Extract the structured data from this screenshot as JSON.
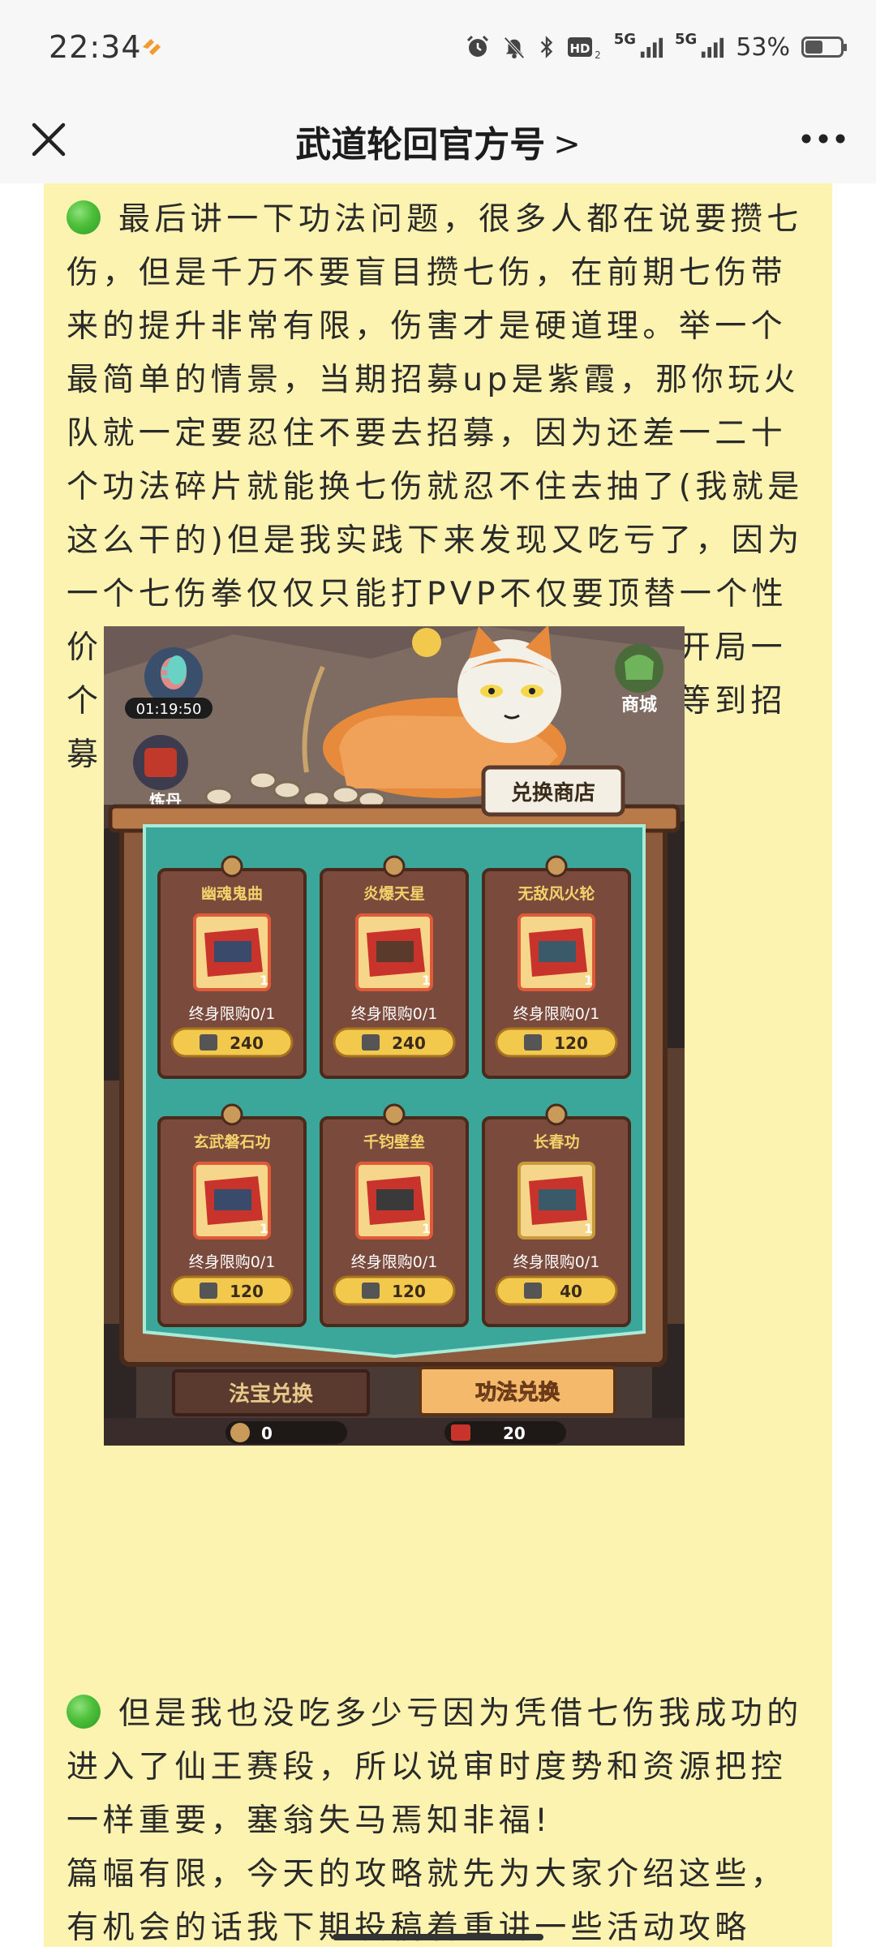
{
  "status_bar": {
    "time": "22:34",
    "network_1": "5G",
    "network_2": "5G",
    "hd_badge": "HD",
    "battery": "53%",
    "icons": [
      "alarm-icon",
      "mute-icon",
      "bluetooth-icon",
      "hd-icon",
      "signal-icon",
      "signal-icon",
      "battery-icon"
    ]
  },
  "nav": {
    "title": "武道轮回官方号",
    "chevron": ">",
    "close_icon": "close-icon",
    "more_icon": "more-icon"
  },
  "article": {
    "paragraph_1": "最后讲一下功法问题，很多人都在说要攒七伤，但是千万不要盲目攒七伤，在前期七伤带来的提升非常有限，伤害才是硬道理。举一个最简单的情景，当期招募up是紫霞，那你玩火队就一定要忍住不要去招募，因为还差一二十个功法碎片就能换七伤就忍不住去抽了(我就是这么干的)但是我实践下来发现又吃亏了，因为一个七伤拳仅仅只能打PVP不仅要顶替一个性价比较高的功法，而且还不如别人琪琪开局一个大带来的收益高。玩火队可以再忍忍等到招募up是琪琪再去抽取。",
    "paragraph_2": "但是我也没吃多少亏因为凭借七伤我成功的进入了仙王赛段，所以说审时度势和资源把控一样重要，塞翁失马焉知非福!",
    "paragraph_3": "篇幅有限，今天的攻略就先为大家介绍这些，有机会的话我下期投稿着重讲一些活动攻略"
  },
  "game_shot": {
    "timer": "01:19:50",
    "side_label_left": "炼丹",
    "side_label_right": "商城",
    "shop_title": "兑换商店",
    "limit_text": "终身限购0/1",
    "items": [
      {
        "name": "幽魂鬼曲",
        "count": "1",
        "price": "240"
      },
      {
        "name": "炎爆天星",
        "count": "1",
        "price": "240"
      },
      {
        "name": "无敌风火轮",
        "count": "1",
        "price": "120"
      },
      {
        "name": "玄武磐石功",
        "count": "1",
        "price": "120"
      },
      {
        "name": "千钧壁垒",
        "count": "1",
        "price": "120"
      },
      {
        "name": "长春功",
        "count": "1",
        "price": "40"
      }
    ],
    "tab_left": "法宝兑换",
    "tab_right": "功法兑换",
    "currency_1": "0",
    "currency_2": "20",
    "colors": {
      "board_teal": "#3aa79a",
      "card_brown": "#7a4a3c",
      "price_gold": "#f2c94c",
      "tab_active": "#f4b96a"
    }
  },
  "colors": {
    "article_bg": "#fdf3b0",
    "bar_bg": "#f7f7f7",
    "bullet_green": "#4cbf3a"
  }
}
